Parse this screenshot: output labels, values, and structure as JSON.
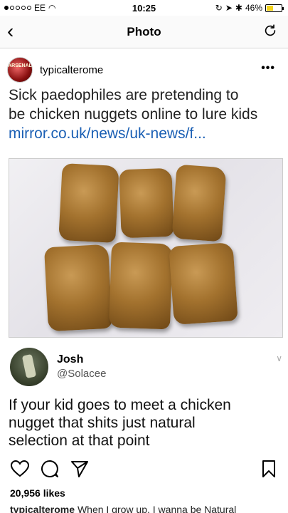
{
  "status_bar": {
    "carrier": "EE",
    "time": "10:25",
    "battery_percent": "46%",
    "battery_level": 0.46
  },
  "nav": {
    "title": "Photo",
    "back_icon": "chevron-left-icon",
    "refresh_icon": "refresh-icon"
  },
  "post": {
    "username": "typicalterome",
    "avatar_text": "ARSENAL",
    "caption_lines": [
      "Sick paedophiles are pretending to",
      "be chicken nuggets online to lure kids"
    ],
    "caption_link": "mirror.co.uk/news/uk-news/f..."
  },
  "tweet": {
    "name": "Josh",
    "handle": "@Solacee",
    "text_lines": [
      "If your kid goes to meet a chicken",
      "nugget that shits just natural",
      "selection at that point"
    ]
  },
  "actions": {
    "likes": "20,956 likes"
  },
  "comment": {
    "user": "typicalterome",
    "text": "When I grow up, I wanna be Natural"
  }
}
